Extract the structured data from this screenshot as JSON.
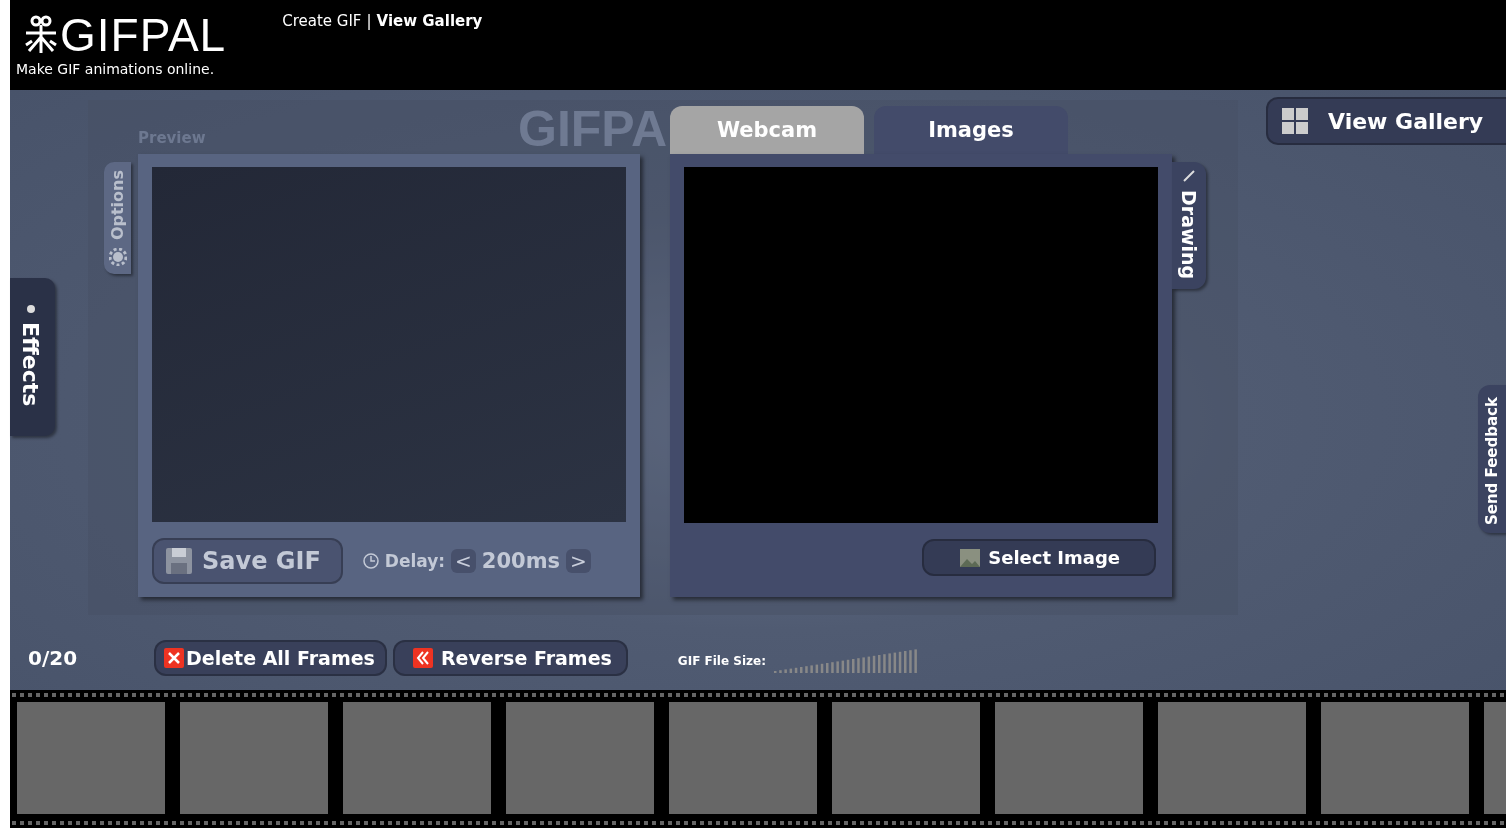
{
  "header": {
    "logo": "GIFPAL",
    "tagline": "Make GIF animations online.",
    "nav": [
      {
        "label": "Create GIF",
        "selected": false
      },
      {
        "label": "View Gallery",
        "selected": true
      }
    ],
    "separator": "|"
  },
  "background_logo": "GIFPA",
  "side_tabs": {
    "effects": "Effects",
    "options": "Options",
    "drawing": "Drawing",
    "feedback": "Send Feedback"
  },
  "preview": {
    "label": "Preview",
    "save_button": "Save GIF",
    "delay_label": "Delay:",
    "delay_value": "200ms",
    "decrease": "<",
    "increase": ">"
  },
  "source_tabs": [
    {
      "label": "Webcam",
      "selected": false
    },
    {
      "label": "Images",
      "selected": true
    }
  ],
  "select_image_button": "Select Image",
  "view_gallery_button": "View Gallery",
  "toolbar": {
    "frame_count": "0/20",
    "delete_button": "Delete All Frames",
    "reverse_button": "Reverse Frames",
    "file_size_label": "GIF File Size:"
  },
  "frame_slots": [
    {
      "kind": "empty"
    },
    {
      "kind": "empty"
    },
    {
      "kind": "empty"
    },
    {
      "kind": "empty"
    },
    {
      "kind": "empty"
    },
    {
      "kind": "empty"
    },
    {
      "kind": "empty"
    },
    {
      "kind": "empty"
    },
    {
      "kind": "empty"
    },
    {
      "kind": "empty"
    }
  ]
}
